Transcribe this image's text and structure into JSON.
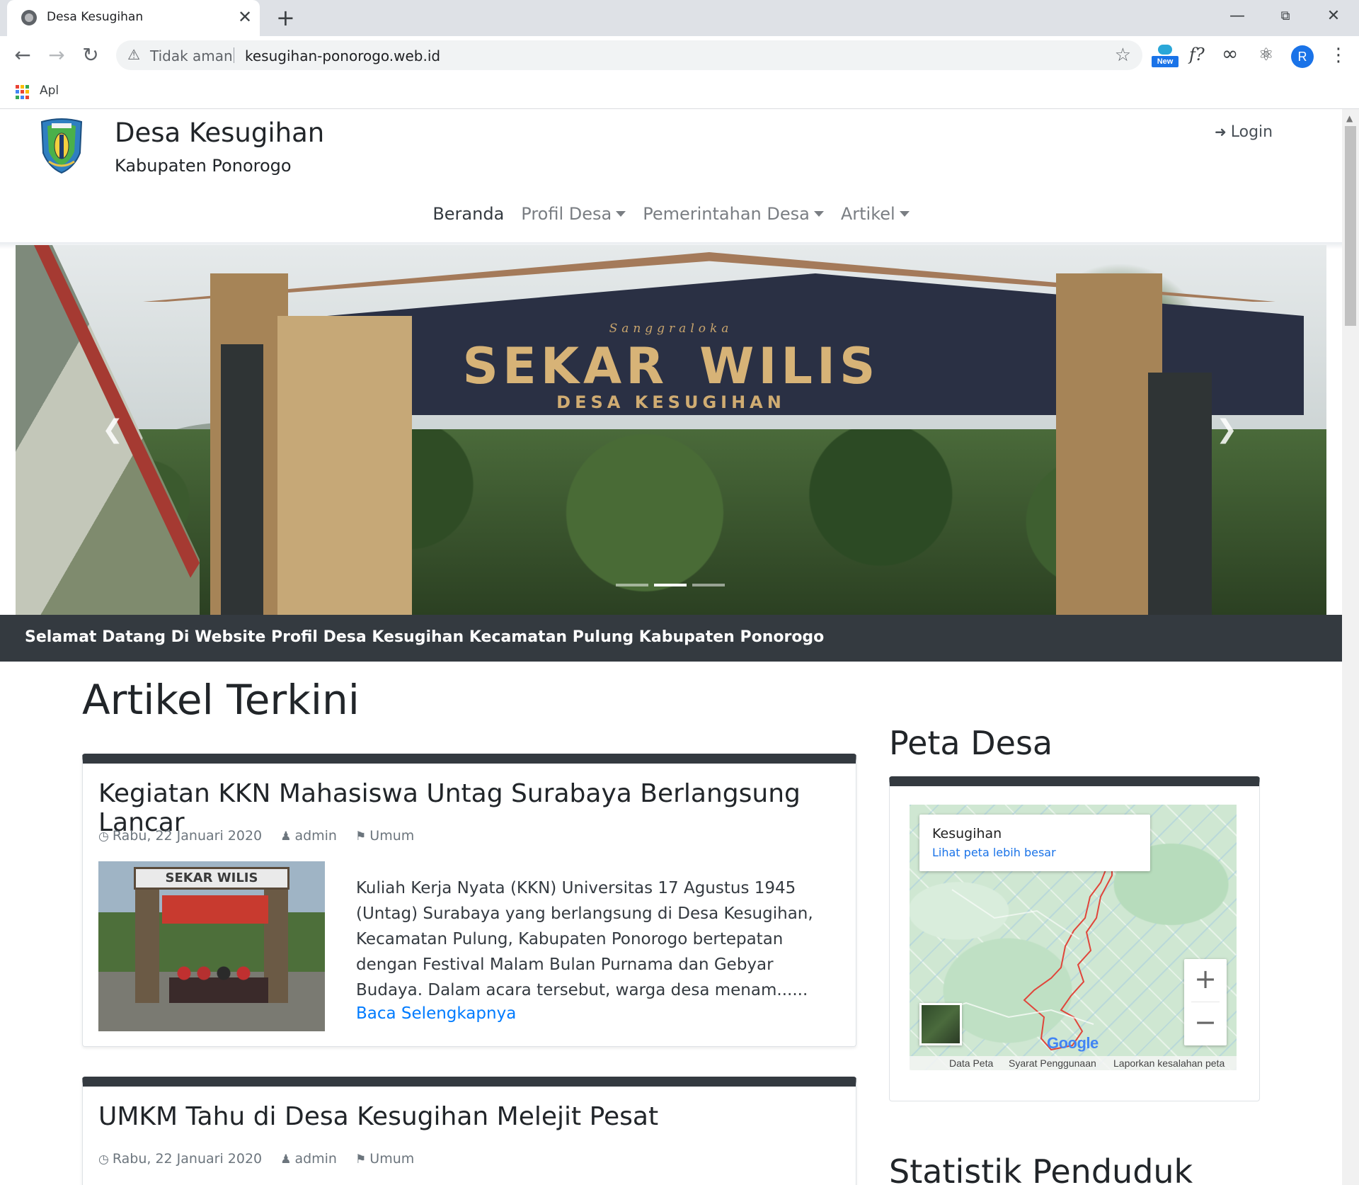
{
  "browser": {
    "tab_title": "Desa Kesugihan",
    "tab_close": "✕",
    "new_tab": "+",
    "security_label": "Tidak aman",
    "url": "kesugihan-ponorogo.web.id",
    "extension_badge": "New",
    "ext_formula": "f?",
    "ext_infinity": "∞",
    "profile_initial": "R",
    "bookmarks_apps_label": "Apl"
  },
  "site": {
    "title": "Desa Kesugihan",
    "subtitle": "Kabupaten Ponorogo",
    "login_label": "Login"
  },
  "nav": {
    "items": [
      {
        "label": "Beranda",
        "active": true,
        "dropdown": false
      },
      {
        "label": "Profil Desa",
        "active": false,
        "dropdown": true
      },
      {
        "label": "Pemerintahan Desa",
        "active": false,
        "dropdown": true
      },
      {
        "label": "Artikel",
        "active": false,
        "dropdown": true
      }
    ]
  },
  "carousel": {
    "slide_small_text": "Sanggraloka",
    "slide_title_1": "SEKAR",
    "slide_title_2": "WILIS",
    "slide_subtitle": "DESA  KESUGIHAN",
    "slide_count": 3,
    "active_index": 1
  },
  "welcome": "Selamat Datang Di Website Profil Desa Kesugihan Kecamatan Pulung Kabupaten Ponorogo",
  "articles": {
    "heading": "Artikel Terkini",
    "items": [
      {
        "title": "Kegiatan KKN Mahasiswa Untag Surabaya Berlangsung Lancar",
        "date": "Rabu, 22 Januari 2020",
        "author": "admin",
        "category": "Umum",
        "thumb_sign": "SEKAR WILIS",
        "excerpt": "Kuliah Kerja Nyata (KKN) Universitas 17 Agustus 1945 (Untag) Surabaya yang berlangsung di Desa Kesugihan, Kecamatan Pulung, Kabupaten Ponorogo bertepatan dengan Festival Malam Bulan Purnama dan Gebyar Budaya. Dalam acara tersebut, warga desa menam......",
        "read_more": "Baca Selengkapnya"
      },
      {
        "title": "UMKM Tahu di Desa Kesugihan Melejit Pesat",
        "date": "Rabu, 22 Januari 2020",
        "author": "admin",
        "category": "Umum"
      }
    ]
  },
  "map": {
    "heading": "Peta Desa",
    "place": "Kesugihan",
    "larger_link": "Lihat peta lebih besar",
    "zoom_in": "+",
    "zoom_out": "−",
    "brand": "Google",
    "footer": [
      "Data Peta",
      "Syarat Penggunaan",
      "Laporkan kesalahan peta"
    ]
  },
  "stats": {
    "heading": "Statistik Penduduk"
  },
  "colors": {
    "dark": "#343a40",
    "link": "#007bff",
    "chrome_tab_bg": "#dee1e6",
    "boundary": "#e0453a"
  }
}
